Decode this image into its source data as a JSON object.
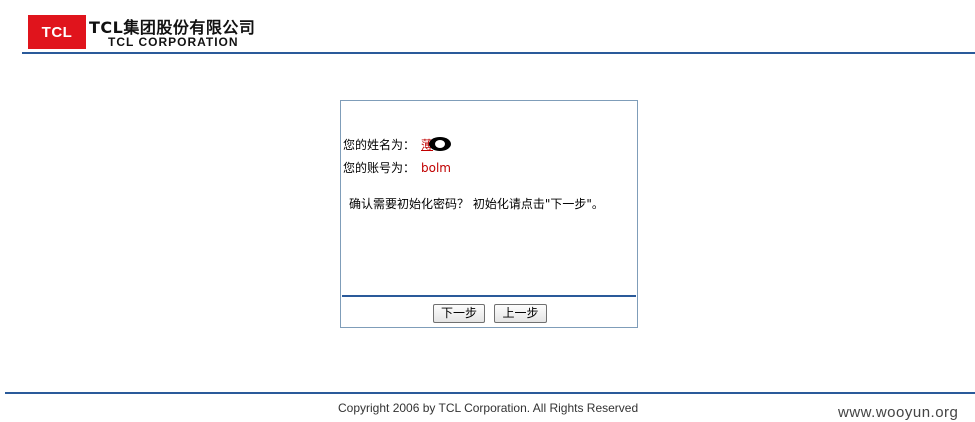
{
  "header": {
    "logo_text": "TCL",
    "company_name_cn": "TCL集团股份有限公司",
    "company_name_en": "TCL CORPORATION"
  },
  "panel": {
    "name_label": "您的姓名为：",
    "name_value": "薄",
    "account_label": "您的账号为：",
    "account_value": "bolm",
    "confirm_text": "确认需要初始化密码？ 初始化请点击\"下一步\"。",
    "next_button": "下一步",
    "prev_button": "上一步"
  },
  "footer": {
    "copyright": "Copyright 2006 by TCL Corporation. All Rights Reserved",
    "watermark": "www.wooyun.org"
  },
  "colors": {
    "brand_red": "#e0141c",
    "rule_blue": "#2a5a9a",
    "value_red": "#c00000"
  }
}
